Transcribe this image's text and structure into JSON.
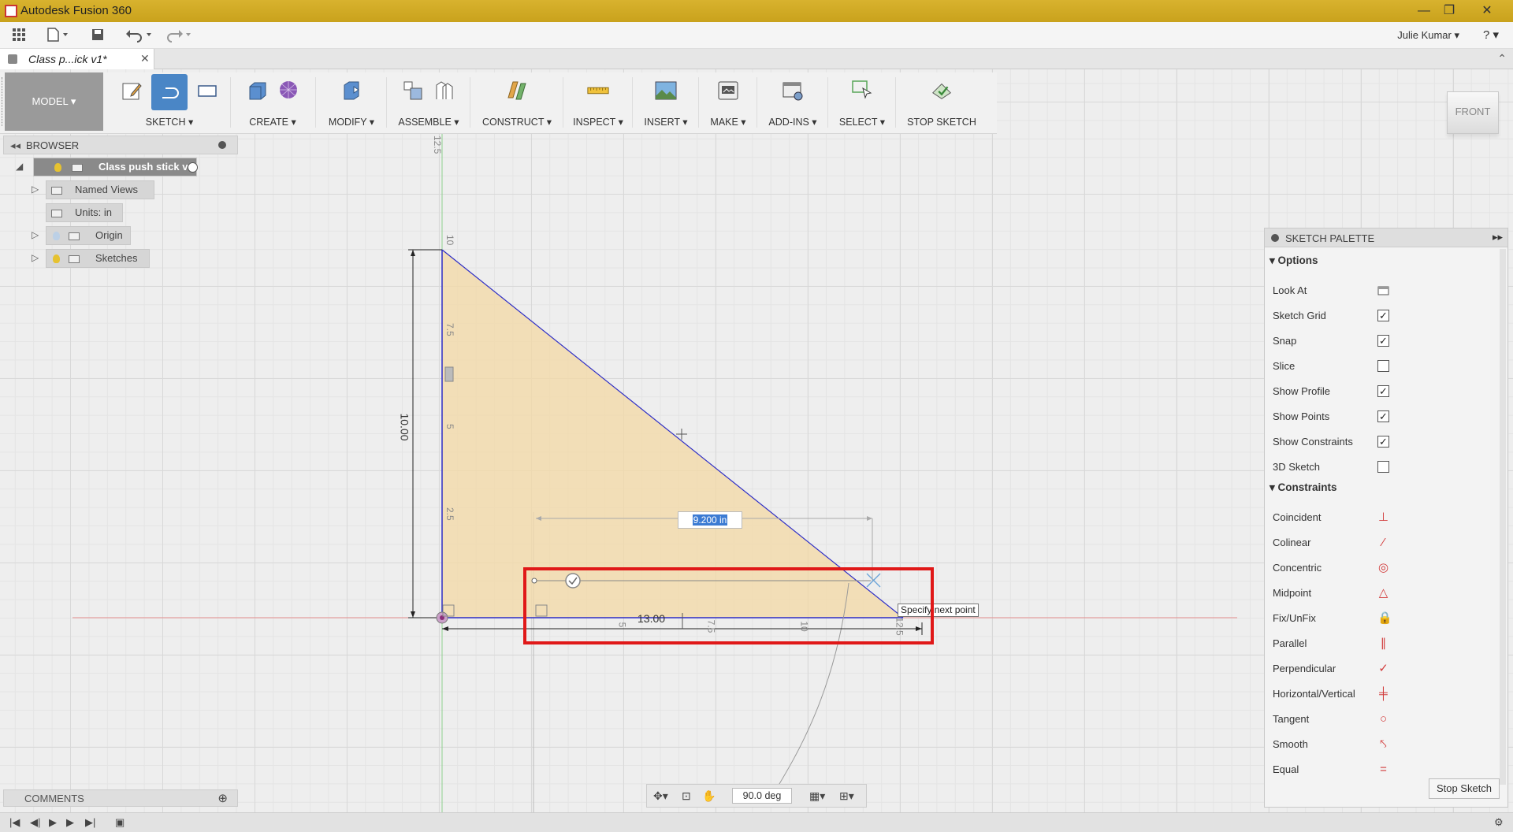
{
  "window": {
    "title": "Autodesk Fusion 360",
    "controls": {
      "minimize": "—",
      "maximize": "❐",
      "close": "✕"
    }
  },
  "quick_access": {
    "user": "Julie Kumar ▾",
    "help": "? ▾"
  },
  "document_tab": {
    "name": "Class p...ick v1*",
    "close": "✕"
  },
  "toolbar": {
    "mode": "MODEL ▾",
    "groups": [
      {
        "label": "SKETCH ▾"
      },
      {
        "label": "CREATE ▾"
      },
      {
        "label": "MODIFY ▾"
      },
      {
        "label": "ASSEMBLE ▾"
      },
      {
        "label": "CONSTRUCT ▾"
      },
      {
        "label": "INSPECT ▾"
      },
      {
        "label": "INSERT ▾"
      },
      {
        "label": "MAKE ▾"
      },
      {
        "label": "ADD-INS ▾"
      },
      {
        "label": "SELECT ▾"
      },
      {
        "label": "STOP SKETCH"
      }
    ]
  },
  "viewcube": {
    "face": "FRONT"
  },
  "browser": {
    "title": "BROWSER",
    "collapse": "◂◂",
    "root": "Class push stick v0",
    "items": [
      {
        "label": "Named Views"
      },
      {
        "label": "Units: in"
      },
      {
        "label": "Origin"
      },
      {
        "label": "Sketches"
      }
    ]
  },
  "comments": {
    "title": "COMMENTS",
    "add": "⊕"
  },
  "sketch": {
    "dimension_value": "9.200 in",
    "vertical_dimension": "10.00",
    "horizontal_dimension": "13.00",
    "tooltip": "Specify next point",
    "ruler_vertical": [
      "12.5",
      "10",
      "7.5",
      "5",
      "2.5"
    ],
    "ruler_horizontal": [
      "5",
      "7.5",
      "10",
      "12.5"
    ]
  },
  "sketch_palette": {
    "title": "SKETCH PALETTE",
    "expand": "▸▸",
    "sections": {
      "options": "Options",
      "constraints": "Constraints"
    },
    "options": [
      {
        "label": "Look At",
        "control": "look-at",
        "checked": null
      },
      {
        "label": "Sketch Grid",
        "control": "checkbox",
        "checked": true
      },
      {
        "label": "Snap",
        "control": "checkbox",
        "checked": true
      },
      {
        "label": "Slice",
        "control": "checkbox",
        "checked": false
      },
      {
        "label": "Show Profile",
        "control": "checkbox",
        "checked": true
      },
      {
        "label": "Show Points",
        "control": "checkbox",
        "checked": true
      },
      {
        "label": "Show Constraints",
        "control": "checkbox",
        "checked": true
      },
      {
        "label": "3D Sketch",
        "control": "checkbox",
        "checked": false
      }
    ],
    "constraints": [
      {
        "label": "Coincident",
        "icon": "coincident-icon",
        "glyph": "⊥"
      },
      {
        "label": "Colinear",
        "icon": "colinear-icon",
        "glyph": "⁄"
      },
      {
        "label": "Concentric",
        "icon": "concentric-icon",
        "glyph": "◎"
      },
      {
        "label": "Midpoint",
        "icon": "midpoint-icon",
        "glyph": "△"
      },
      {
        "label": "Fix/UnFix",
        "icon": "lock-icon",
        "glyph": "🔒"
      },
      {
        "label": "Parallel",
        "icon": "parallel-icon",
        "glyph": "∥"
      },
      {
        "label": "Perpendicular",
        "icon": "perpendicular-icon",
        "glyph": "✓"
      },
      {
        "label": "Horizontal/Vertical",
        "icon": "horizontal-vertical-icon",
        "glyph": "╪"
      },
      {
        "label": "Tangent",
        "icon": "tangent-icon",
        "glyph": "○"
      },
      {
        "label": "Smooth",
        "icon": "smooth-icon",
        "glyph": "⤣"
      },
      {
        "label": "Equal",
        "icon": "equal-icon",
        "glyph": "="
      }
    ],
    "stop_button": "Stop Sketch"
  },
  "navbar": {
    "angle": "90.0 deg"
  },
  "colors": {
    "title_bar": "#c9a21c",
    "profile_fill": "#f3d9a9",
    "sketch_line": "#2d2dc6",
    "highlight": "#e01818",
    "active_tool": "#4a86c6"
  }
}
